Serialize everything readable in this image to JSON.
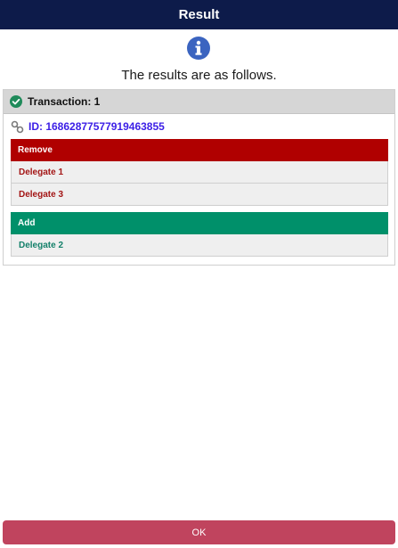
{
  "titlebar": {
    "title": "Result"
  },
  "icons": {
    "info": "info-icon",
    "check": "check-circle-icon",
    "link": "link-icon"
  },
  "message": "The results are as follows.",
  "transaction": {
    "header": "Transaction: 1",
    "id_label": "ID: 1686287757791946385​5"
  },
  "remove_group": {
    "header": "Remove",
    "items": [
      "Delegate 1",
      "Delegate 3"
    ]
  },
  "add_group": {
    "header": "Add",
    "items": [
      "Delegate 2"
    ]
  },
  "ok_button": {
    "label": "OK"
  },
  "colors": {
    "titlebar": "#0d1b4a",
    "remove": "#b00000",
    "add": "#00906a",
    "ok": "#c0445e",
    "id_text": "#3b1ee6"
  }
}
